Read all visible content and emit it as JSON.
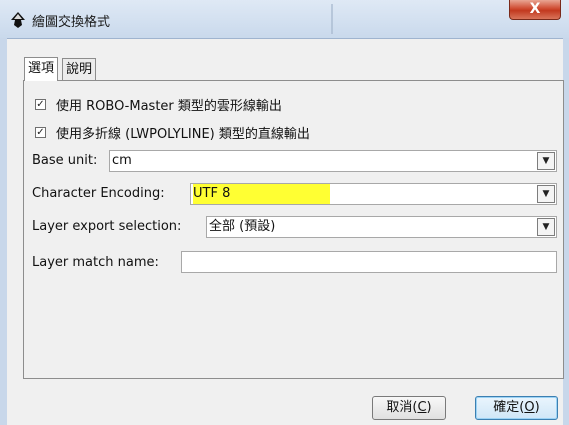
{
  "window": {
    "title": "繪圖交換格式",
    "close_label": "X"
  },
  "tabs": [
    {
      "label": "選項",
      "active": true
    },
    {
      "label": "說明",
      "active": false
    }
  ],
  "options": {
    "robo_master": {
      "label": "使用 ROBO-Master 類型的雲形線輸出",
      "checked": true
    },
    "lwpolyline": {
      "label": "使用多折線 (LWPOLYLINE) 類型的直線輸出",
      "checked": true
    },
    "base_unit": {
      "label": "Base unit:",
      "value": "cm"
    },
    "character_encoding": {
      "label": "Character Encoding:",
      "value": "UTF 8",
      "highlight_color": "#ffff33"
    },
    "layer_export_selection": {
      "label": "Layer export selection:",
      "value": "全部 (預設)"
    },
    "layer_match_name": {
      "label": "Layer match name:",
      "value": ""
    }
  },
  "buttons": {
    "cancel": {
      "text": "取消(",
      "mnemonic": "C",
      "suffix": ")"
    },
    "ok": {
      "text": "確定(",
      "mnemonic": "O",
      "suffix": ")"
    }
  },
  "icons": {
    "app": "inkscape-icon",
    "dropdown": "chevron-down-icon",
    "check": "check-icon"
  }
}
